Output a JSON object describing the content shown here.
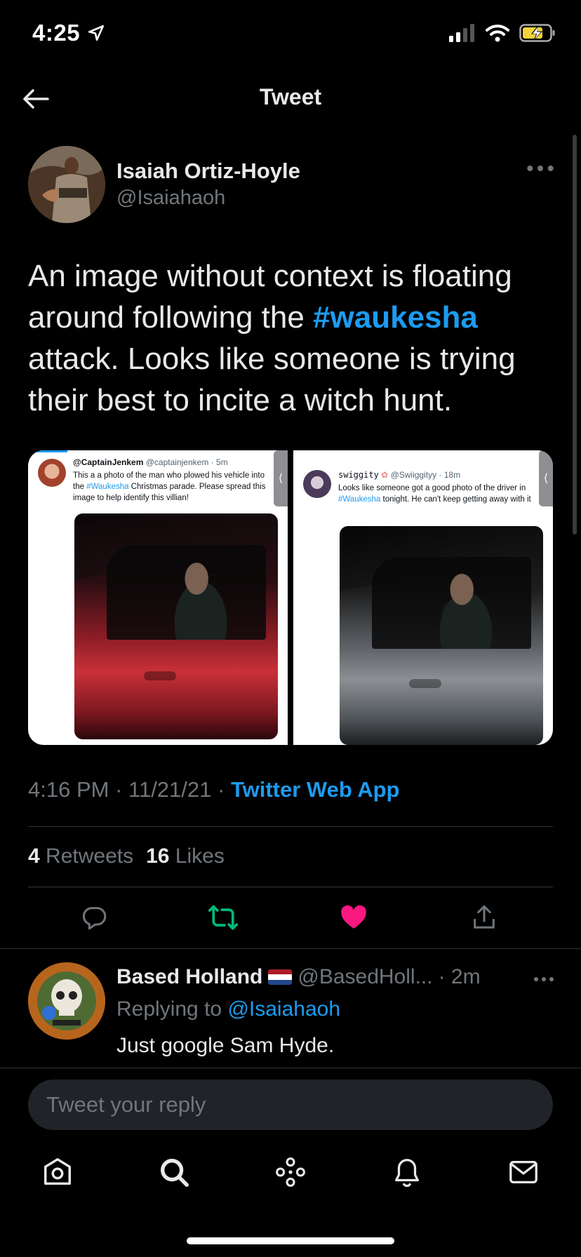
{
  "status_bar": {
    "time": "4:25"
  },
  "nav": {
    "title": "Tweet"
  },
  "tweet": {
    "author_name": "Isaiah Ortiz-Hoyle",
    "author_handle": "@Isaiahaoh",
    "text_before": "An image without context is floating around following the ",
    "hashtag": "#waukesha",
    "text_after": " attack. Looks like someone is trying their best to incite a witch hunt.",
    "time": "4:16 PM",
    "date": "11/21/21",
    "source": "Twitter Web App",
    "retweets_count": "4",
    "retweets_label": "Retweets",
    "likes_count": "16",
    "likes_label": "Likes"
  },
  "media": [
    {
      "name": "@CaptainJenkem",
      "handle": "@captainjenkem · 5m",
      "text_a": "This a a photo of the man who plowed his vehicle into the ",
      "tag": "#Waukesha",
      "text_b": " Christmas parade. Please spread this image to help identify this villian!"
    },
    {
      "name": "swiggity",
      "handle": "@Swiiggityy · 18m",
      "text_a": "Looks like someone got a good photo of the driver in ",
      "tag": "#Waukesha",
      "text_b": " tonight. He can't keep getting away with it"
    }
  ],
  "reply": {
    "name": "Based Holland",
    "handle": "@BasedHoll...",
    "time": "· 2m",
    "replying_prefix": "Replying to",
    "replying_handle": "@Isaiahaoh",
    "text": "Just google Sam Hyde."
  },
  "composer": {
    "placeholder": "Tweet your reply"
  },
  "colors": {
    "accent": "#1d9bf0",
    "like": "#f91880",
    "retweet": "#00ba7c",
    "battery": "#f5d33b"
  },
  "icons": [
    "back-arrow-icon",
    "reply-icon",
    "retweet-icon",
    "like-icon",
    "share-icon",
    "home-icon",
    "search-icon",
    "spaces-icon",
    "notifications-icon",
    "messages-icon"
  ]
}
